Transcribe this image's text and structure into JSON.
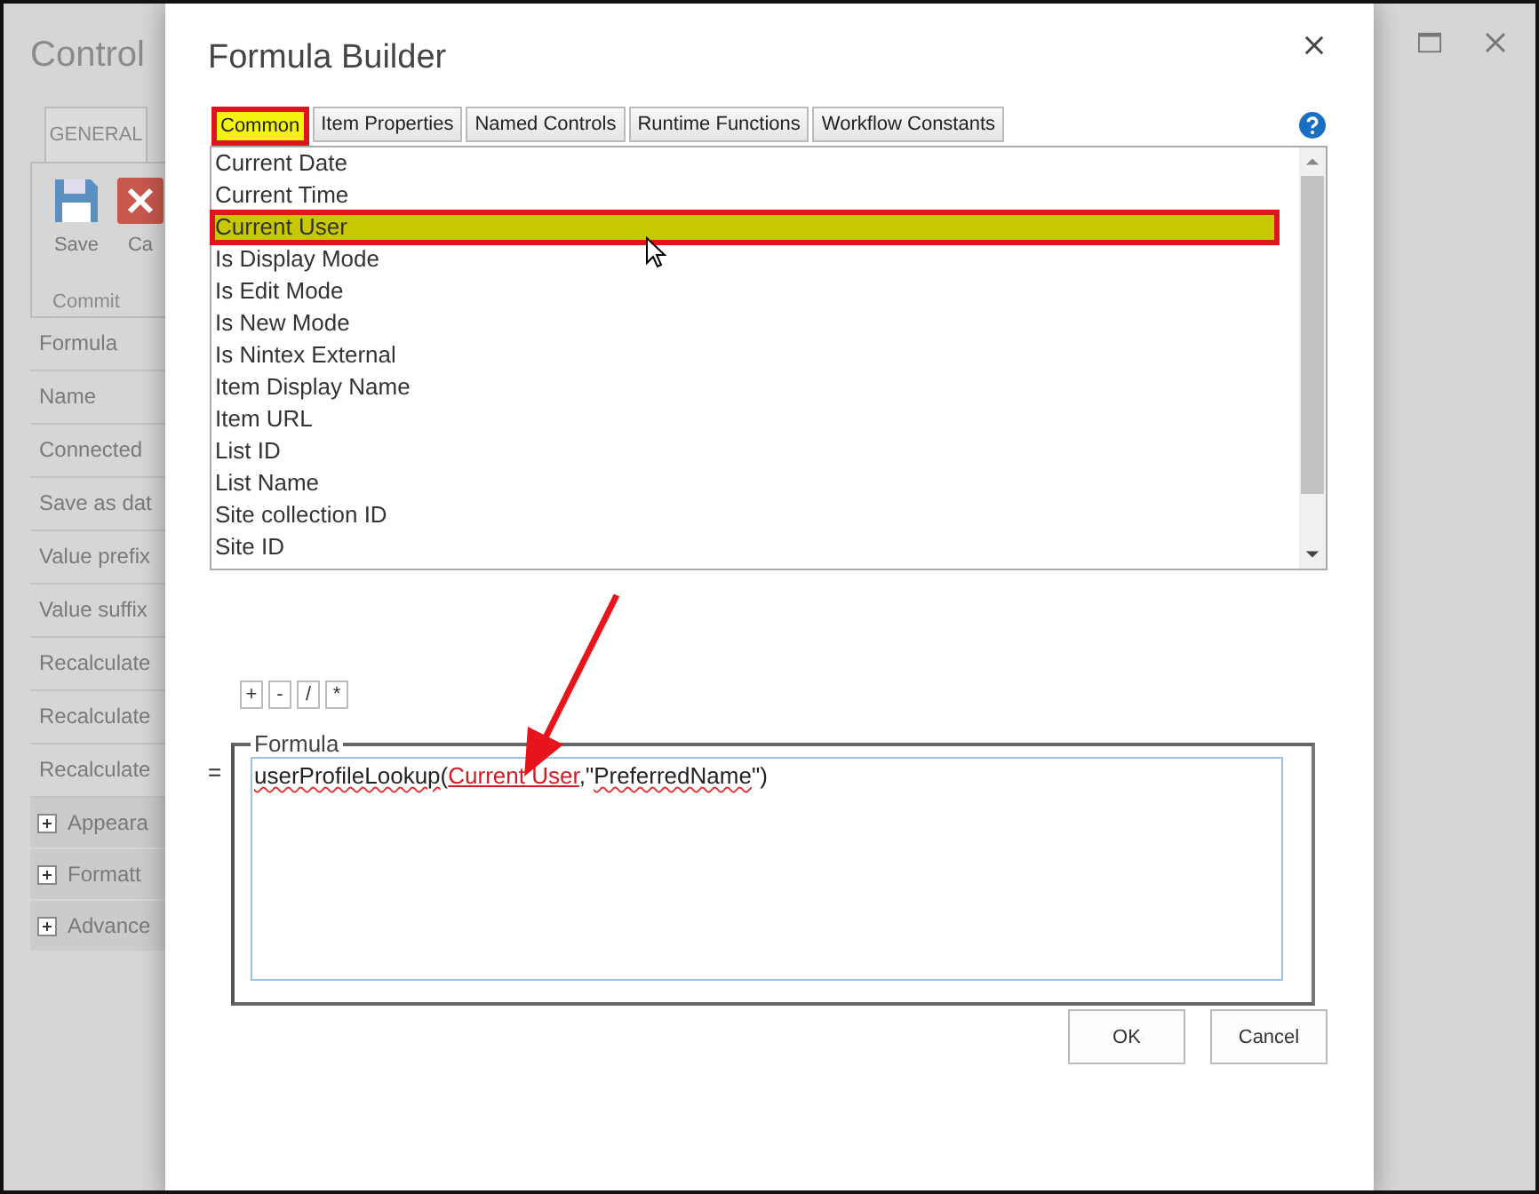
{
  "background": {
    "title": "Control",
    "ribbon_tab": "GENERAL",
    "ribbon_buttons": [
      {
        "label": "Save",
        "kind": "save"
      },
      {
        "label": "Ca",
        "kind": "cancel"
      }
    ],
    "ribbon_group": "Commit",
    "properties": [
      "Formula",
      "Name",
      "Connected",
      "Save as dat",
      "Value prefix",
      "Value suffix",
      "Recalculate",
      "Recalculate",
      "Recalculate"
    ],
    "sections": [
      {
        "label": "Appeara",
        "expanded": false
      },
      {
        "label": "Formatt",
        "expanded": false
      },
      {
        "label": "Advance",
        "expanded": false
      }
    ]
  },
  "dialog": {
    "title": "Formula Builder",
    "tabs": [
      {
        "label": "Common",
        "selected": true
      },
      {
        "label": "Item Properties",
        "selected": false
      },
      {
        "label": "Named Controls",
        "selected": false
      },
      {
        "label": "Runtime Functions",
        "selected": false
      },
      {
        "label": "Workflow Constants",
        "selected": false
      }
    ],
    "items": [
      {
        "label": "Current Date",
        "selected": false
      },
      {
        "label": "Current Time",
        "selected": false
      },
      {
        "label": "Current User",
        "selected": true
      },
      {
        "label": "Is Display Mode",
        "selected": false
      },
      {
        "label": "Is Edit Mode",
        "selected": false
      },
      {
        "label": "Is New Mode",
        "selected": false
      },
      {
        "label": "Is Nintex External",
        "selected": false
      },
      {
        "label": "Item Display Name",
        "selected": false
      },
      {
        "label": "Item URL",
        "selected": false
      },
      {
        "label": "List ID",
        "selected": false
      },
      {
        "label": "List Name",
        "selected": false
      },
      {
        "label": "Site collection ID",
        "selected": false
      },
      {
        "label": "Site ID",
        "selected": false
      }
    ],
    "operators": [
      "+",
      "-",
      "/",
      "*"
    ],
    "equals": "=",
    "formula_legend": "Formula",
    "formula": [
      {
        "text": "userProfileLookup",
        "kind": "misspelled"
      },
      {
        "text": "(",
        "kind": "plain"
      },
      {
        "text": "Current User",
        "kind": "reference"
      },
      {
        "text": ",\"",
        "kind": "plain"
      },
      {
        "text": "PreferredName",
        "kind": "misspelled"
      },
      {
        "text": "\")",
        "kind": "plain"
      }
    ],
    "buttons": [
      "OK",
      "Cancel"
    ]
  }
}
